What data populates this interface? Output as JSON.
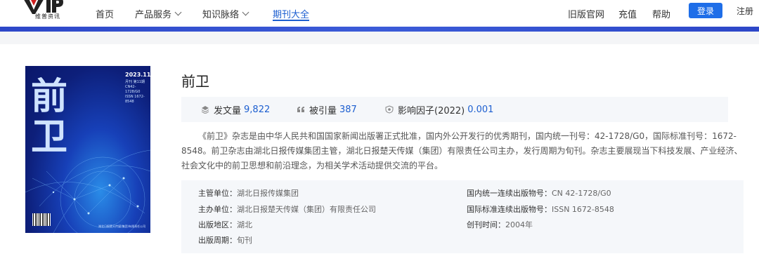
{
  "header": {
    "logo_text": "VIP",
    "logo_subtext": "维普资讯",
    "nav": [
      {
        "label": "首页"
      },
      {
        "label": "产品服务"
      },
      {
        "label": "知识脉络"
      },
      {
        "label": "期刊大全"
      }
    ],
    "right_links": [
      {
        "label": "旧版官网"
      },
      {
        "label": "充值"
      },
      {
        "label": "帮助"
      }
    ],
    "login_label": "登录",
    "register_label": "注册"
  },
  "journal": {
    "title": "前卫",
    "cover": {
      "title_chars": [
        "前",
        "卫"
      ],
      "issue_date": "2023.11",
      "info_text": "月刊 第11期 CN42-1728/G0 ISSN 1672-8548",
      "footer_text": "湖北日报楚天传媒(集团)有限责任公司"
    },
    "stats": [
      {
        "label": "发文量",
        "value": "9,822",
        "icon": "stack-icon"
      },
      {
        "label": "被引量",
        "value": "387",
        "icon": "quote-icon"
      },
      {
        "label": "影响因子(2022)",
        "value": "0.001",
        "icon": "shield-icon"
      }
    ],
    "description": "《前卫》杂志是由中华人民共和国国家新闻出版署正式批准，国内外公开发行的优秀期刊，国内统一刊号：42-1728/G0，国际标准刊号：1672-8548。前卫杂志由湖北日报传媒集团主管，湖北日报楚天传媒（集团）有限责任公司主办，发行周期为旬刊。杂志主要展现当下科技发展、产业经济、社会文化中的前卫思想和前沿理念，为相关学术活动提供交流的平台。",
    "info_left": [
      {
        "label": "主管单位：",
        "value": "湖北日报传媒集团"
      },
      {
        "label": "主办单位：",
        "value": "湖北日报楚天传媒（集团）有限责任公司"
      },
      {
        "label": "出版地区：",
        "value": "湖北"
      },
      {
        "label": "出版周期：",
        "value": "旬刊"
      }
    ],
    "info_right": [
      {
        "label": "国内统一连续出版物号：",
        "value": "CN 42-1728/G0"
      },
      {
        "label": "国际标准连续出版物号：",
        "value": "ISSN 1672-8548"
      },
      {
        "label": "创刊时间：",
        "value": "2004年"
      }
    ]
  },
  "colors": {
    "accent": "#1f6ee8",
    "band": "#2d47c8",
    "link": "#1d5fd0"
  }
}
